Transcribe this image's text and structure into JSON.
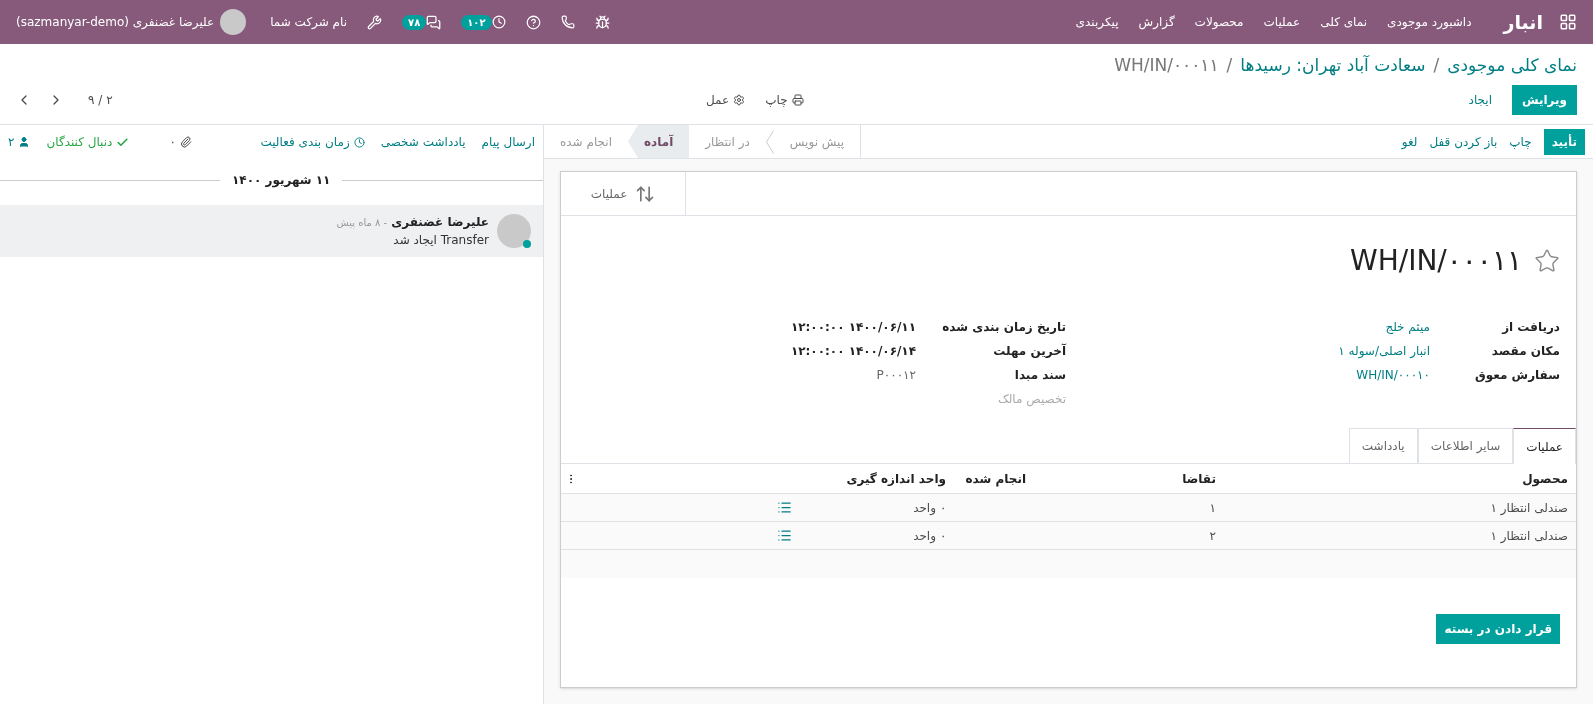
{
  "navbar": {
    "brand": "انبار",
    "menu": [
      "داشبورد موجودی",
      "نمای کلی",
      "عملیات",
      "محصولات",
      "گزارش",
      "پیکربندی"
    ],
    "systray": {
      "activity_count": "۱۰۲",
      "message_count": "۷۸",
      "company": "نام شرکت شما",
      "user": "علیرضا غضنفری (sazmanyar-demo)"
    }
  },
  "control_panel": {
    "breadcrumbs": [
      {
        "label": "نمای کلی موجودی",
        "link": true
      },
      {
        "label": "سعادت آباد تهران: رسیدها",
        "link": true
      },
      {
        "label": "WH/IN/۰۰۰۱۱",
        "link": false
      }
    ],
    "separator": "/",
    "main_buttons": [
      {
        "label": "ویرایش",
        "primary": true
      },
      {
        "label": "ایجاد",
        "primary": false
      }
    ],
    "actions": [
      {
        "label": "چاپ",
        "kind": "print"
      },
      {
        "label": "عمل",
        "kind": "action"
      }
    ],
    "pager": "۲ / ۹"
  },
  "statusbar": {
    "buttons": [
      {
        "label": "تأیید",
        "primary": true
      },
      {
        "label": "چاپ",
        "primary": false
      },
      {
        "label": "باز کردن قفل",
        "primary": false
      },
      {
        "label": "لغو",
        "primary": false
      }
    ],
    "stages": [
      {
        "label": "پیش نویس",
        "selected": false
      },
      {
        "label": "در انتظار",
        "selected": false
      },
      {
        "label": "آماده",
        "selected": true
      },
      {
        "label": "انجام شده",
        "selected": false
      }
    ]
  },
  "form": {
    "smart_button": "عملیات",
    "title": "WH/IN/۰۰۰۱۱",
    "starred": false,
    "fields_right": [
      {
        "label": "دریافت از",
        "value": "میثم خلج"
      },
      {
        "label": "مکان مقصد",
        "value": "انبار اصلی/سوله ۱"
      },
      {
        "label": "سفارش معوق",
        "value": "WH/IN/۰۰۰۱۰"
      }
    ],
    "fields_left": [
      {
        "label": "تاریخ زمان بندی شده",
        "value": "۱۴۰۰/۰۶/۱۱ ۱۲:۰۰:۰۰",
        "kind": "bold"
      },
      {
        "label": "آخرین مهلت",
        "value": "۱۴۰۰/۰۶/۱۴ ۱۲:۰۰:۰۰",
        "kind": "bold"
      },
      {
        "label": "سند مبدا",
        "value": "P۰۰۰۱۲",
        "kind": "plain"
      },
      {
        "label": "تخصیص مالک",
        "kind": "empty"
      }
    ],
    "tabs": [
      {
        "label": "عملیات",
        "selected": true
      },
      {
        "label": "سایر اطلاعات",
        "selected": false
      },
      {
        "label": "یادداشت",
        "selected": false
      }
    ],
    "table": {
      "columns": [
        "محصول",
        "تقاضا",
        "انجام شده",
        "واحد اندازه گیری"
      ],
      "rows": [
        {
          "product": "صندلی انتظار ۱",
          "demand": "۱",
          "done": "۰",
          "uom": "واحد"
        },
        {
          "product": "صندلی انتظار ۱",
          "demand": "۲",
          "done": "۰",
          "uom": "واحد"
        }
      ]
    },
    "package_button": "قرار دادن در بسته"
  },
  "chatter": {
    "actions": [
      "ارسال پیام",
      "یادداشت شخصی",
      "زمان بندی فعالیت"
    ],
    "attachments": "۰",
    "followers": "دنبال کنندگان",
    "follower_count": "۲",
    "date": "۱۱ شهریور ۱۴۰۰",
    "messages": [
      {
        "author": "علیرضا غضنفری",
        "time": "- ۸ ماه پیش",
        "body": "Transfer ایجاد شد",
        "online": true
      }
    ]
  }
}
